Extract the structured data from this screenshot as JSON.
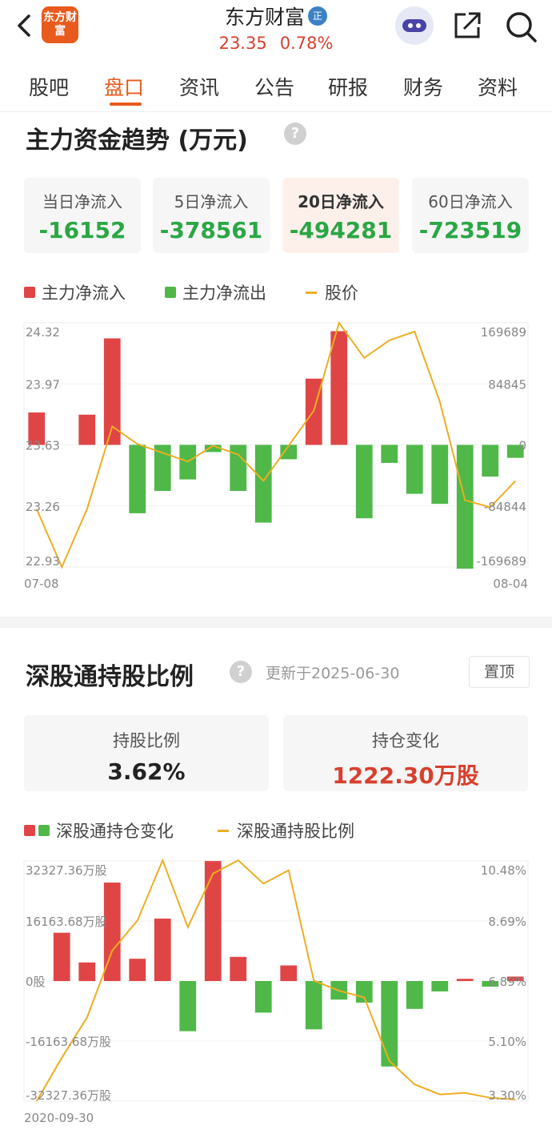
{
  "header": {
    "logo_text": "东方财富",
    "stock_name": "东方财富",
    "badge": "正",
    "price": "23.35",
    "change_pct": "0.78%"
  },
  "tabs": [
    "股吧",
    "盘口",
    "资讯",
    "公告",
    "研报",
    "财务",
    "资料"
  ],
  "active_tab": "盘口",
  "fund_section": {
    "title": "主力资金趋势 (万元)",
    "help": "?",
    "cards": [
      {
        "label": "当日净流入",
        "value": "-16152"
      },
      {
        "label": "5日净流入",
        "value": "-378561"
      },
      {
        "label": "20日净流入",
        "value": "-494281"
      },
      {
        "label": "60日净流入",
        "value": "-723519"
      }
    ],
    "active_card": 2,
    "legend": {
      "inflow": "主力净流入",
      "outflow": "主力净流出",
      "price": "股价"
    }
  },
  "holding_section": {
    "title": "深股通持股比例",
    "help": "?",
    "update": "更新于2025-06-30",
    "pin": "置顶",
    "cards": [
      {
        "label": "持股比例",
        "value": "3.62%"
      },
      {
        "label": "持仓变化",
        "value": "1222.30万股"
      }
    ],
    "legend": {
      "bars": "深股通持仓变化",
      "line": "深股通持股比例"
    }
  },
  "chart_data": [
    {
      "type": "bar",
      "title": "主力资金趋势 (万元)",
      "left_ticks": [
        "24.32",
        "23.97",
        "23.63",
        "23.26",
        "22.93"
      ],
      "right_ticks": [
        "169689",
        "84845",
        "0",
        "-84844",
        "-169689"
      ],
      "x_start": "07-08",
      "x_end": "08-04",
      "ylim_flow": [
        -169689,
        169689
      ],
      "ylim_price": [
        22.93,
        24.32
      ],
      "series": [
        {
          "name": "主力净流入/主力净流出",
          "values": [
            45000,
            0,
            42000,
            148000,
            -95000,
            -64000,
            -48000,
            -10000,
            -64000,
            -108000,
            -20000,
            92000,
            158000,
            -102000,
            -25000,
            -68000,
            -82000,
            -172000,
            -44000,
            -18000
          ]
        },
        {
          "name": "股价",
          "values": [
            23.26,
            22.93,
            23.26,
            23.73,
            23.63,
            23.58,
            23.53,
            23.62,
            23.57,
            23.42,
            23.62,
            23.82,
            24.32,
            24.12,
            24.22,
            24.27,
            23.87,
            23.31,
            23.27,
            23.42
          ]
        }
      ],
      "colors": {
        "inflow": "#e04545",
        "outflow": "#4fb848",
        "price": "#ecae22"
      }
    },
    {
      "type": "bar",
      "title": "深股通持股比例",
      "left_ticks": [
        "32327.36万股",
        "16163.68万股",
        "0股",
        "-16163.68万股",
        "-32327.36万股"
      ],
      "right_ticks": [
        "10.48%",
        "8.69%",
        "6.89%",
        "5.10%",
        "3.30%"
      ],
      "x_start": "2020-09-30",
      "ylim_change": [
        -32327.36,
        32327.36
      ],
      "ylim_ratio": [
        3.3,
        10.48
      ],
      "series": [
        {
          "name": "深股通持仓变化",
          "values": [
            0,
            13000,
            5000,
            26500,
            6000,
            16800,
            -13500,
            32300,
            6500,
            -8500,
            4200,
            -13000,
            -5000,
            -5800,
            -23000,
            -7500,
            -2800,
            600,
            -1500,
            1200
          ]
        },
        {
          "name": "深股通持股比例",
          "values": [
            3.3,
            4.6,
            5.8,
            7.8,
            8.7,
            10.5,
            8.5,
            10.1,
            10.5,
            9.8,
            10.2,
            6.9,
            6.6,
            6.4,
            4.5,
            3.8,
            3.5,
            3.55,
            3.4,
            3.35
          ]
        }
      ],
      "colors": {
        "increase": "#e04545",
        "decrease": "#4fb848",
        "ratio": "#ecae22"
      }
    }
  ]
}
